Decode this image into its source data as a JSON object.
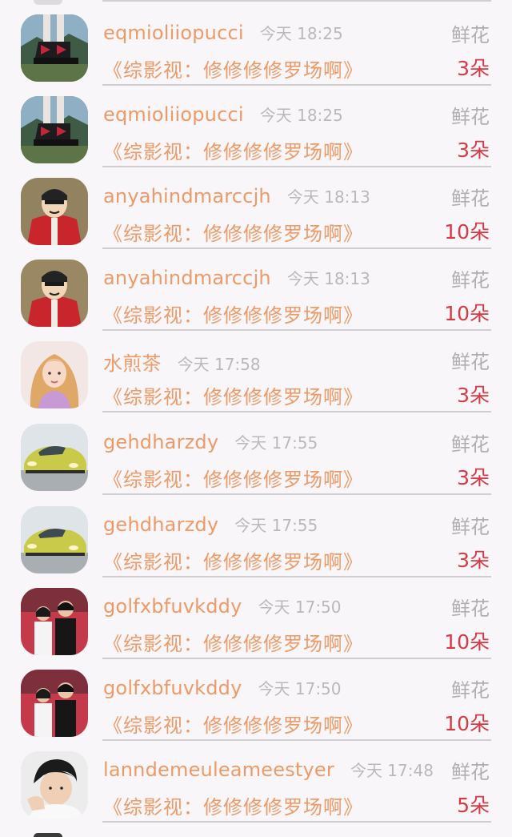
{
  "rows": [
    {
      "username": "eqmioliiopucci",
      "time": "今天 18:25",
      "gift_label": "鲜花",
      "book": "《综影视：修修修修罗场啊》",
      "count": "3朵",
      "avatar": "sneakers"
    },
    {
      "username": "eqmioliiopucci",
      "time": "今天 18:25",
      "gift_label": "鲜花",
      "book": "《综影视：修修修修罗场啊》",
      "count": "3朵",
      "avatar": "sneakers"
    },
    {
      "username": "anyahindmarccjh",
      "time": "今天 18:13",
      "gift_label": "鲜花",
      "book": "《综影视：修修修修罗场啊》",
      "count": "10朵",
      "avatar": "cartoon-red-jacket"
    },
    {
      "username": "anyahindmarccjh",
      "time": "今天 18:13",
      "gift_label": "鲜花",
      "book": "《综影视：修修修修罗场啊》",
      "count": "10朵",
      "avatar": "cartoon-red-jacket"
    },
    {
      "username": "水煎茶",
      "time": "今天 17:58",
      "gift_label": "鲜花",
      "book": "《综影视：修修修修罗场啊》",
      "count": "3朵",
      "avatar": "illustrated-girl"
    },
    {
      "username": "gehdharzdy",
      "time": "今天 17:55",
      "gift_label": "鲜花",
      "book": "《综影视：修修修修罗场啊》",
      "count": "3朵",
      "avatar": "yellow-car"
    },
    {
      "username": "gehdharzdy",
      "time": "今天 17:55",
      "gift_label": "鲜花",
      "book": "《综影视：修修修修罗场啊》",
      "count": "3朵",
      "avatar": "yellow-car"
    },
    {
      "username": "golfxbfuvkddy",
      "time": "今天 17:50",
      "gift_label": "鲜花",
      "book": "《综影视：修修修修罗场啊》",
      "count": "10朵",
      "avatar": "couple-photo"
    },
    {
      "username": "golfxbfuvkddy",
      "time": "今天 17:50",
      "gift_label": "鲜花",
      "book": "《综影视：修修修修罗场啊》",
      "count": "10朵",
      "avatar": "couple-photo"
    },
    {
      "username": "lanndemeuleameestyer",
      "time": "今天 17:48",
      "gift_label": "鲜花",
      "book": "《综影视：修修修修罗场啊》",
      "count": "5朵",
      "avatar": "young-man"
    }
  ],
  "colors": {
    "username": "#ec9a68",
    "book_title": "#ec9a68",
    "count": "#d63a45",
    "muted": "#aeaeb3",
    "background": "#f8f6f8"
  }
}
